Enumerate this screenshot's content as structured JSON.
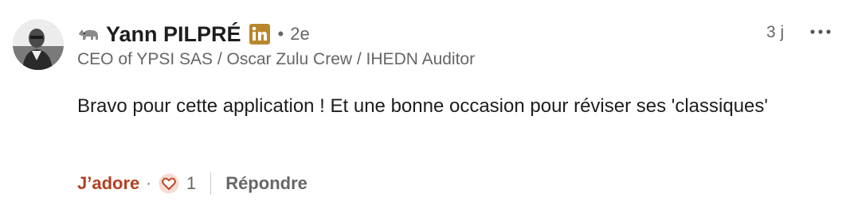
{
  "comment": {
    "author": {
      "name": "Yann PILPRÉ",
      "emoji": "rhino-icon",
      "degree": "2e",
      "separator": "•",
      "headline": "CEO of YPSI SAS / Oscar Zulu Crew / IHEDN Auditor",
      "badge": "linkedin-premium-icon",
      "badge_color": "#b8862b"
    },
    "timestamp": "3 j",
    "more_icon": "more-horizontal-icon",
    "text": "Bravo pour cette application ! Et une bonne occasion pour réviser ses 'classiques'",
    "actions": {
      "like_label": "J’adore",
      "like_color": "#b24020",
      "separator": "·",
      "reaction_icon": "heart-reaction-icon",
      "reaction_count": "1",
      "reply_label": "Répondre"
    }
  }
}
